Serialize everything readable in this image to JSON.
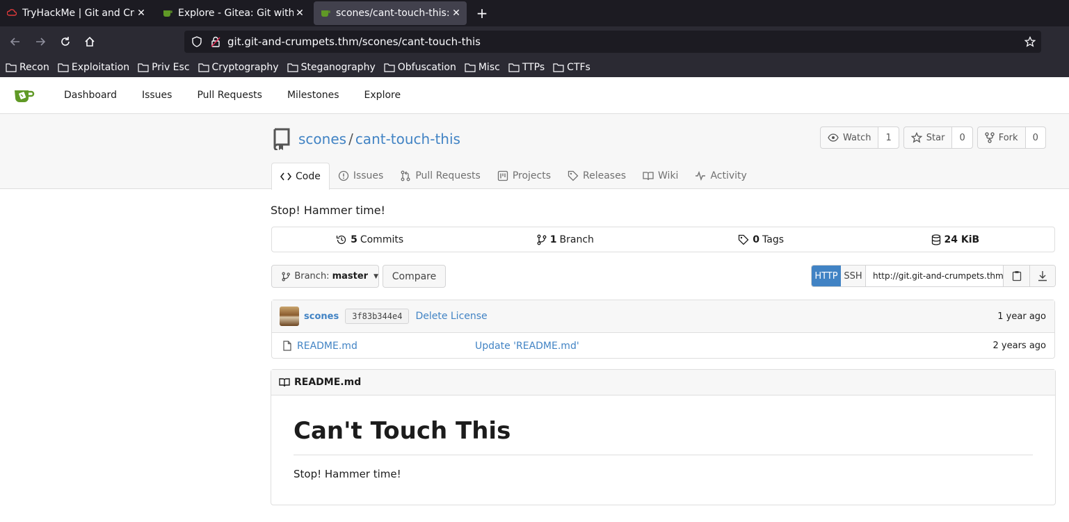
{
  "browser": {
    "tabs": [
      {
        "title": "TryHackMe | Git and Crum",
        "active": false
      },
      {
        "title": "Explore - Gitea: Git with a",
        "active": false
      },
      {
        "title": "scones/cant-touch-this: S",
        "active": true
      }
    ],
    "url": "git.git-and-crumpets.thm/scones/cant-touch-this",
    "bookmarks": [
      "Recon",
      "Exploitation",
      "Priv Esc",
      "Cryptography",
      "Steganography",
      "Obfuscation",
      "Misc",
      "TTPs",
      "CTFs"
    ]
  },
  "gitea_nav": {
    "items": [
      "Dashboard",
      "Issues",
      "Pull Requests",
      "Milestones",
      "Explore"
    ]
  },
  "repo": {
    "owner": "scones",
    "separator": "/",
    "name": "cant-touch-this",
    "actions": {
      "watch_label": "Watch",
      "watch_count": "1",
      "star_label": "Star",
      "star_count": "0",
      "fork_label": "Fork",
      "fork_count": "0"
    },
    "tabs": [
      "Code",
      "Issues",
      "Pull Requests",
      "Projects",
      "Releases",
      "Wiki",
      "Activity"
    ],
    "description": "Stop! Hammer time!",
    "stats": {
      "commits_count": "5",
      "commits_label": "Commits",
      "branches_count": "1",
      "branches_label": "Branch",
      "tags_count": "0",
      "tags_label": "Tags",
      "size": "24 KiB"
    },
    "branch_prefix": "Branch:",
    "branch": "master",
    "compare_label": "Compare",
    "clone": {
      "http_label": "HTTP",
      "ssh_label": "SSH",
      "url": "http://git.git-and-crumpets.thm/scones/cant-touch-this.git"
    },
    "latest_commit": {
      "author": "scones",
      "sha": "3f83b344e4",
      "message": "Delete License",
      "time": "1 year ago"
    },
    "files": [
      {
        "name": "README.md",
        "message": "Update 'README.md'",
        "time": "2 years ago"
      }
    ],
    "readme": {
      "filename": "README.md",
      "heading": "Can't Touch This",
      "body": "Stop! Hammer time!"
    }
  },
  "colors": {
    "link": "#4183c4",
    "accent_button": "#4183c4",
    "browser_dark": "#1c1b22",
    "browser_toolbar": "#2b2a33",
    "gitea_green": "#609926"
  }
}
